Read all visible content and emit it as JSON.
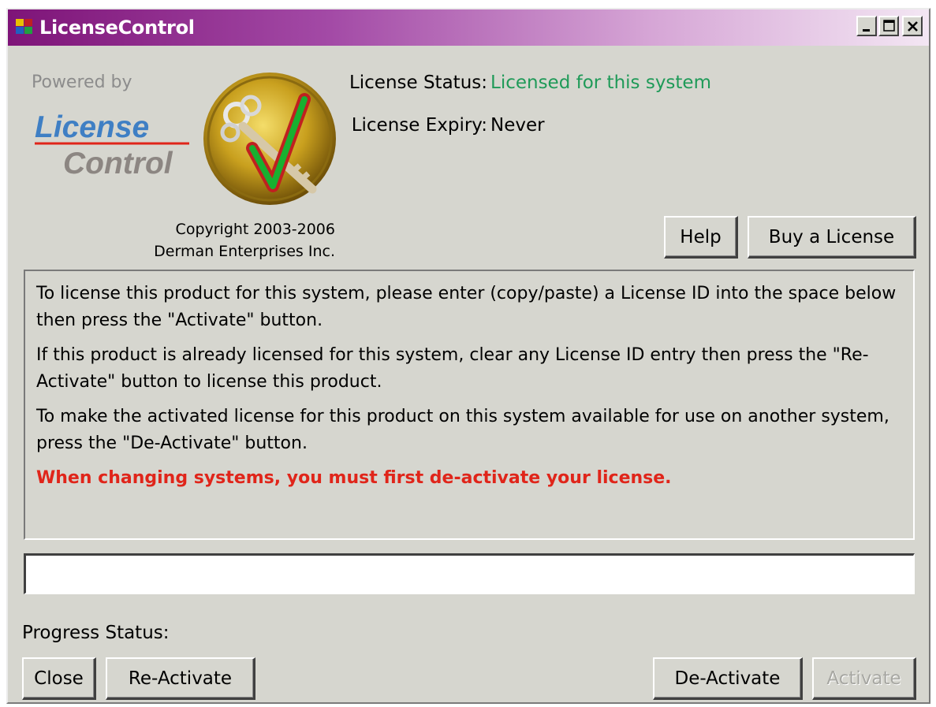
{
  "window": {
    "title": "LicenseControl"
  },
  "branding": {
    "powered_by": "Powered by",
    "logo_line1": "License",
    "logo_line2": "Control",
    "copyright_line1": "Copyright 2003-2006",
    "copyright_line2": "Derman Enterprises Inc."
  },
  "status": {
    "license_status_label": "License Status:",
    "license_status_value": "Licensed for this system",
    "license_expiry_label": "License Expiry:",
    "license_expiry_value": "Never"
  },
  "top_buttons": {
    "help": "Help",
    "buy": "Buy a License"
  },
  "instructions": {
    "p1": "To license this product for this system, please enter (copy/paste) a License ID into the space below then press the \"Activate\" button.",
    "p2": "If this product is already licensed for this system, clear any License ID entry then press the \"Re-Activate\" button to license this product.",
    "p3": "To make the activated license for this product on this system available for use on another system, press the \"De-Activate\" button.",
    "warning": "When changing systems, you must first de-activate your license."
  },
  "license_input": {
    "value": ""
  },
  "progress": {
    "label": "Progress Status:"
  },
  "bottom_buttons": {
    "close": "Close",
    "reactivate": "Re-Activate",
    "deactivate": "De-Activate",
    "activate": "Activate"
  },
  "colors": {
    "title_bar_start": "#7e1478",
    "status_green": "#1f9a58",
    "warning_red": "#e0251a",
    "dialog_bg": "#d6d6cf"
  },
  "icons": [
    "app-icon",
    "minimize-icon",
    "maximize-icon",
    "close-icon",
    "license-seal-icon"
  ]
}
